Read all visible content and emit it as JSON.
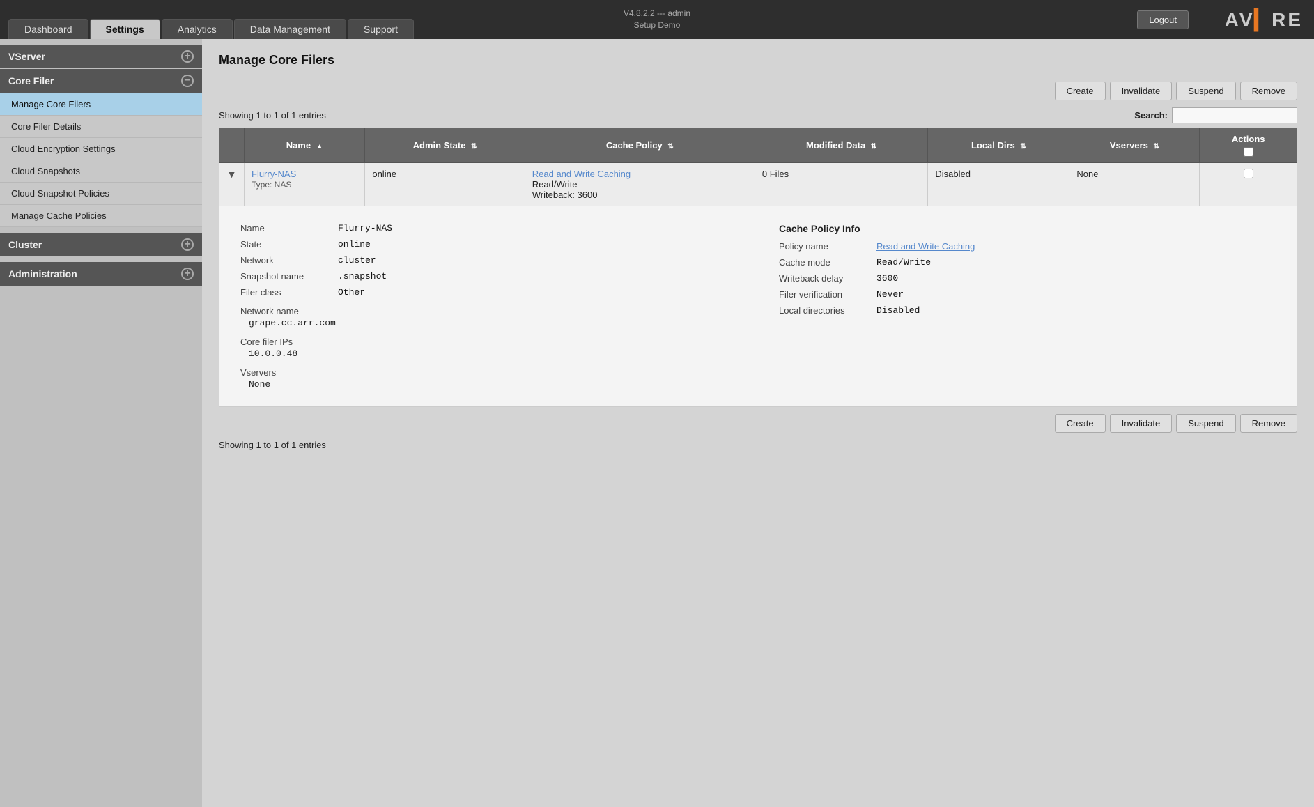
{
  "topbar": {
    "logout_label": "Logout",
    "version": "V4.8.2.2 --- admin",
    "setup_demo": "Setup Demo",
    "logo_text": "AV",
    "logo_accent": "E",
    "logo_rest": "RE",
    "logo_bar": "▐"
  },
  "nav": {
    "tabs": [
      {
        "id": "dashboard",
        "label": "Dashboard",
        "active": false
      },
      {
        "id": "settings",
        "label": "Settings",
        "active": true
      },
      {
        "id": "analytics",
        "label": "Analytics",
        "active": false
      },
      {
        "id": "data-management",
        "label": "Data Management",
        "active": false
      },
      {
        "id": "support",
        "label": "Support",
        "active": false
      }
    ]
  },
  "sidebar": {
    "sections": [
      {
        "id": "vserver",
        "label": "VServer",
        "icon": "+",
        "expanded": false,
        "items": []
      },
      {
        "id": "core-filer",
        "label": "Core Filer",
        "icon": "−",
        "expanded": true,
        "items": [
          {
            "id": "manage-core-filers",
            "label": "Manage Core Filers",
            "active": true
          },
          {
            "id": "core-filer-details",
            "label": "Core Filer Details",
            "active": false
          },
          {
            "id": "cloud-encryption-settings",
            "label": "Cloud Encryption Settings",
            "active": false
          },
          {
            "id": "cloud-snapshots",
            "label": "Cloud Snapshots",
            "active": false
          },
          {
            "id": "cloud-snapshot-policies",
            "label": "Cloud Snapshot Policies",
            "active": false
          },
          {
            "id": "manage-cache-policies",
            "label": "Manage Cache Policies",
            "active": false
          }
        ]
      },
      {
        "id": "cluster",
        "label": "Cluster",
        "icon": "+",
        "expanded": false,
        "items": []
      },
      {
        "id": "administration",
        "label": "Administration",
        "icon": "+",
        "expanded": false,
        "items": []
      }
    ]
  },
  "main": {
    "title": "Manage Core Filers",
    "entries_info_top": "Showing 1 to 1 of 1 entries",
    "entries_info_bottom": "Showing 1 to 1 of 1 entries",
    "search_label": "Search:",
    "search_placeholder": "",
    "buttons": {
      "create": "Create",
      "invalidate": "Invalidate",
      "suspend": "Suspend",
      "remove": "Remove"
    },
    "table": {
      "columns": [
        {
          "id": "expand",
          "label": "",
          "sortable": false
        },
        {
          "id": "name",
          "label": "Name",
          "sortable": true,
          "sort_dir": "asc"
        },
        {
          "id": "admin-state",
          "label": "Admin State",
          "sortable": true
        },
        {
          "id": "cache-policy",
          "label": "Cache Policy",
          "sortable": true
        },
        {
          "id": "modified-data",
          "label": "Modified Data",
          "sortable": true
        },
        {
          "id": "local-dirs",
          "label": "Local Dirs",
          "sortable": true
        },
        {
          "id": "vservers",
          "label": "Vservers",
          "sortable": true
        },
        {
          "id": "actions",
          "label": "Actions",
          "sortable": false
        }
      ],
      "rows": [
        {
          "id": "flurry-nas",
          "name": "Flurry-NAS",
          "type": "Type: NAS",
          "admin_state": "online",
          "cache_policy_link": "Read and Write Caching",
          "cache_policy_mode": "Read/Write",
          "cache_policy_writeback": "Writeback: 3600",
          "modified_data": "0 Files",
          "local_dirs": "Disabled",
          "vservers": "None",
          "expanded": true,
          "detail": {
            "name": "Flurry-NAS",
            "state": "online",
            "network": "cluster",
            "snapshot_name": ".snapshot",
            "filer_class": "Other",
            "network_name": "grape.cc.arr.com",
            "core_filer_ips": "10.0.0.48",
            "vservers": "None",
            "cache_policy_info": {
              "title": "Cache Policy Info",
              "policy_name_link": "Read and Write Caching",
              "cache_mode": "Read/Write",
              "writeback_delay": "3600",
              "filer_verification": "Never",
              "local_directories": "Disabled"
            }
          }
        }
      ]
    }
  }
}
